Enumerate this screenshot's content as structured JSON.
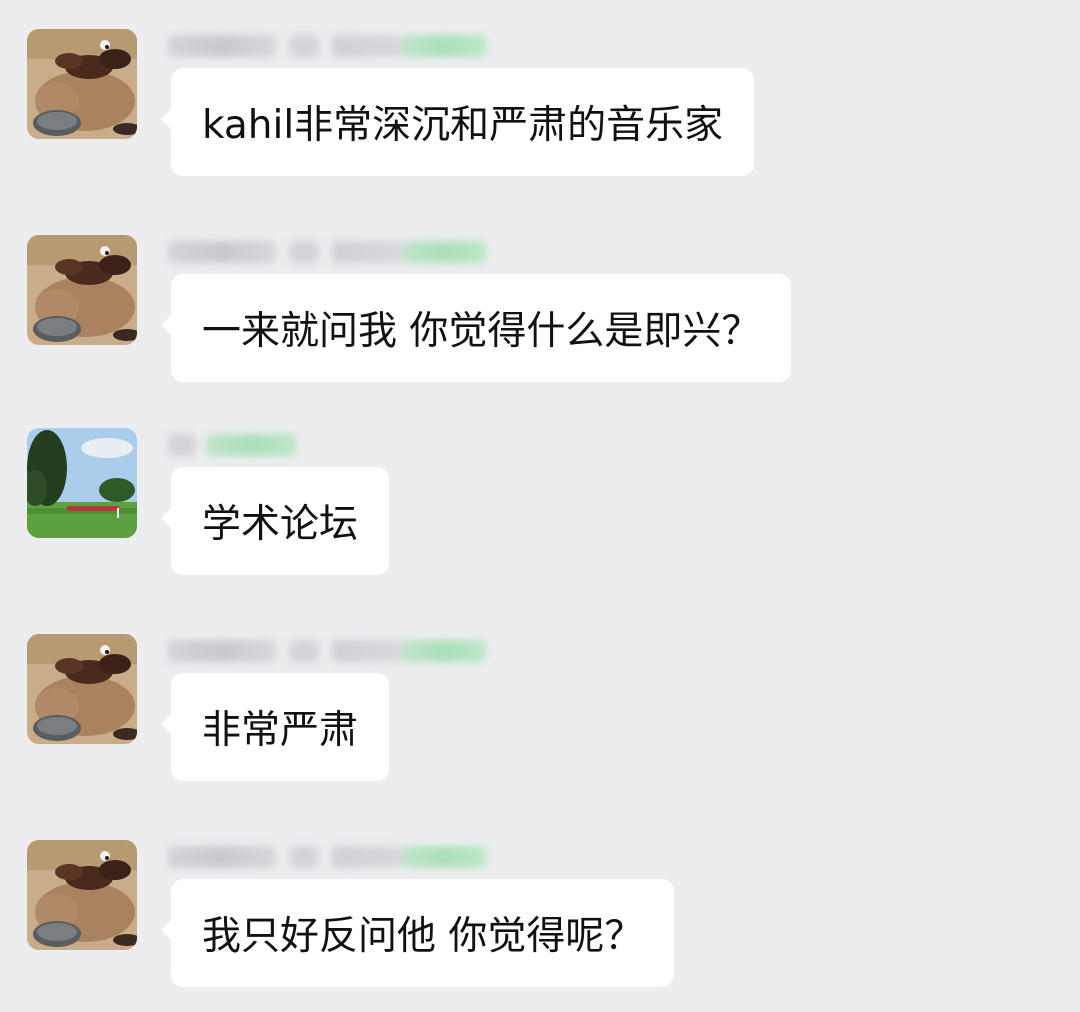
{
  "chat": {
    "messages": [
      {
        "avatar": "capybara-with-ducks-avatar",
        "text": "kahil非常深沉和严肃的音乐家"
      },
      {
        "avatar": "capybara-with-ducks-avatar",
        "text": "一来就问我 你觉得什么是即兴？"
      },
      {
        "avatar": "park-landscape-avatar",
        "text": "学术论坛"
      },
      {
        "avatar": "capybara-with-ducks-avatar",
        "text": "非常严肃"
      },
      {
        "avatar": "capybara-with-ducks-avatar",
        "text": "我只好反问他 你觉得呢？"
      }
    ]
  },
  "colors": {
    "background": "#ededf0",
    "bubble": "#ffffff",
    "text": "#111111"
  }
}
